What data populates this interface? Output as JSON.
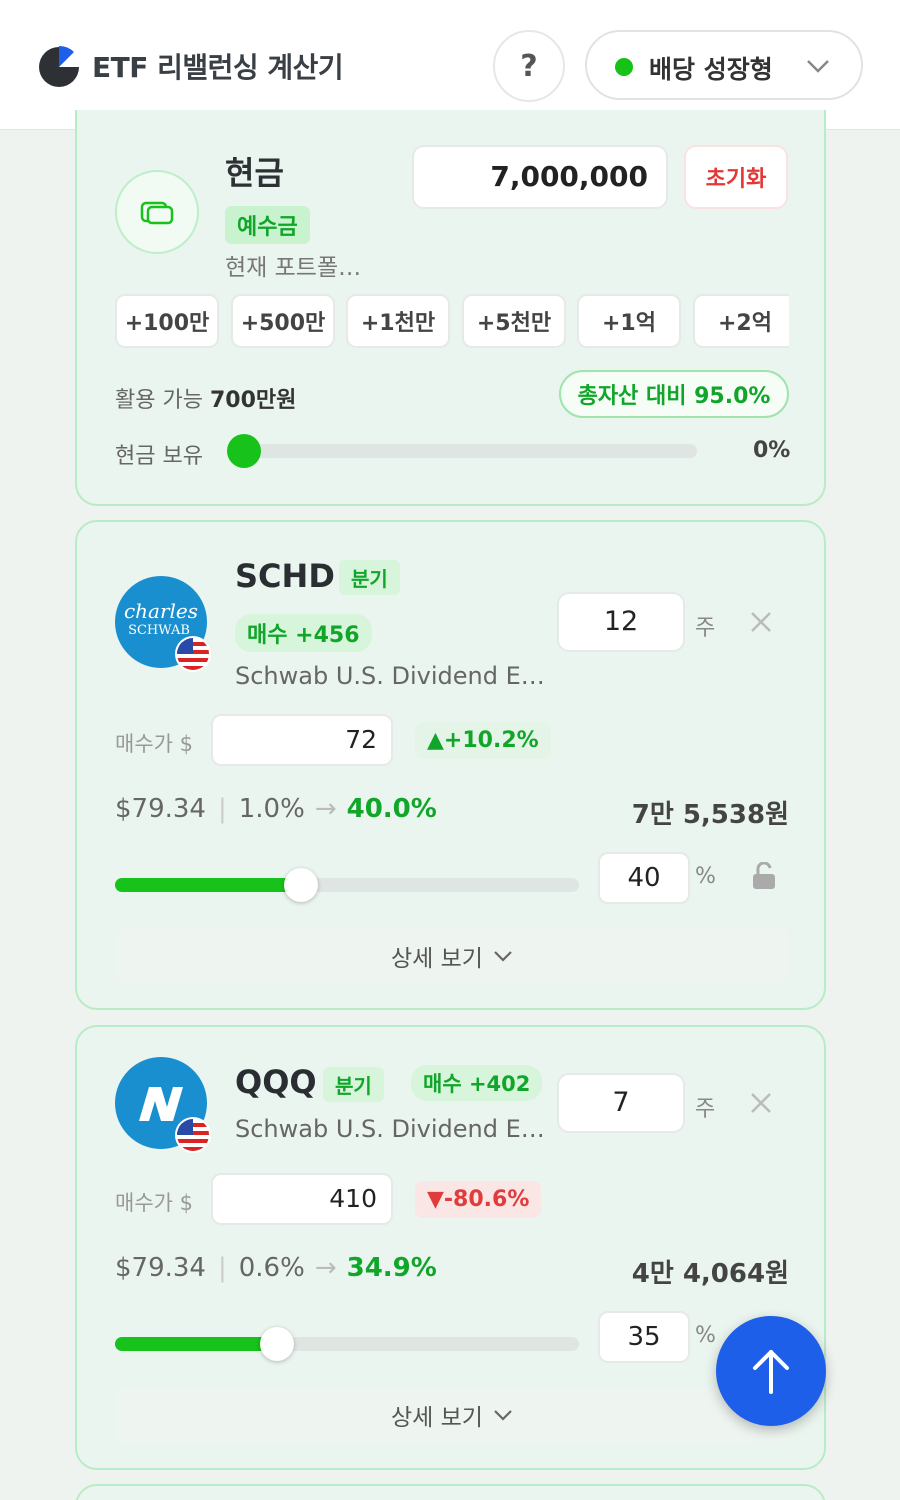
{
  "header": {
    "app_title": "ETF 리밸런싱 계산기",
    "help_label": "?",
    "preset": {
      "label": "배당 성장형",
      "dot_color": "#16c216"
    }
  },
  "cash": {
    "title": "현금",
    "badge": "예수금",
    "subtitle": "현재 포트폴…",
    "amount": "7,000,000",
    "reset_label": "초기화",
    "quick_buttons": [
      "+100만",
      "+500만",
      "+1천만",
      "+5천만",
      "+1억",
      "+2억"
    ],
    "available_prefix": "활용 가능 ",
    "available_value": "700만원",
    "ratio_label": "총자산 대비 95.0%",
    "hold_label": "현금 보유",
    "hold_percent": "0%",
    "hold_fraction": 0
  },
  "etfs": [
    {
      "ticker": "SCHD",
      "freq_badge": "분기",
      "buy_badge": "매수 +456",
      "name": "Schwab U.S. Dividend E…",
      "logo_text": "charles SCHWAB",
      "shares": "12",
      "share_unit": "주",
      "buy_price_label": "매수가 $",
      "buy_price": "72",
      "change": "▲+10.2%",
      "change_dir": "up",
      "price": "$79.34",
      "current_weight": "1.0%",
      "target_weight": "40.0%",
      "amount": "7만 5,538원",
      "weight_input": "40",
      "weight_unit": "%",
      "slider_fraction": 0.4,
      "detail_label": "상세 보기"
    },
    {
      "ticker": "QQQ",
      "freq_badge": "분기",
      "buy_badge": "매수 +402",
      "name": "Schwab U.S. Dividend E…",
      "logo_text": "N",
      "shares": "7",
      "share_unit": "주",
      "buy_price_label": "매수가 $",
      "buy_price": "410",
      "change": "▼-80.6%",
      "change_dir": "down",
      "price": "$79.34",
      "current_weight": "0.6%",
      "target_weight": "34.9%",
      "amount": "4만 4,064원",
      "weight_input": "35",
      "weight_unit": "%",
      "slider_fraction": 0.35,
      "detail_label": "상세 보기"
    }
  ],
  "icons": {
    "logo": "pie-chart-logo-icon",
    "cash": "wallet-icon",
    "close": "close-icon",
    "lock": "unlock-icon",
    "chevron": "chevron-down-icon",
    "fab": "arrow-up-icon"
  },
  "colors": {
    "accent_green": "#17c21a",
    "danger_red": "#e23b3b",
    "fab_blue": "#1d5fe8"
  }
}
